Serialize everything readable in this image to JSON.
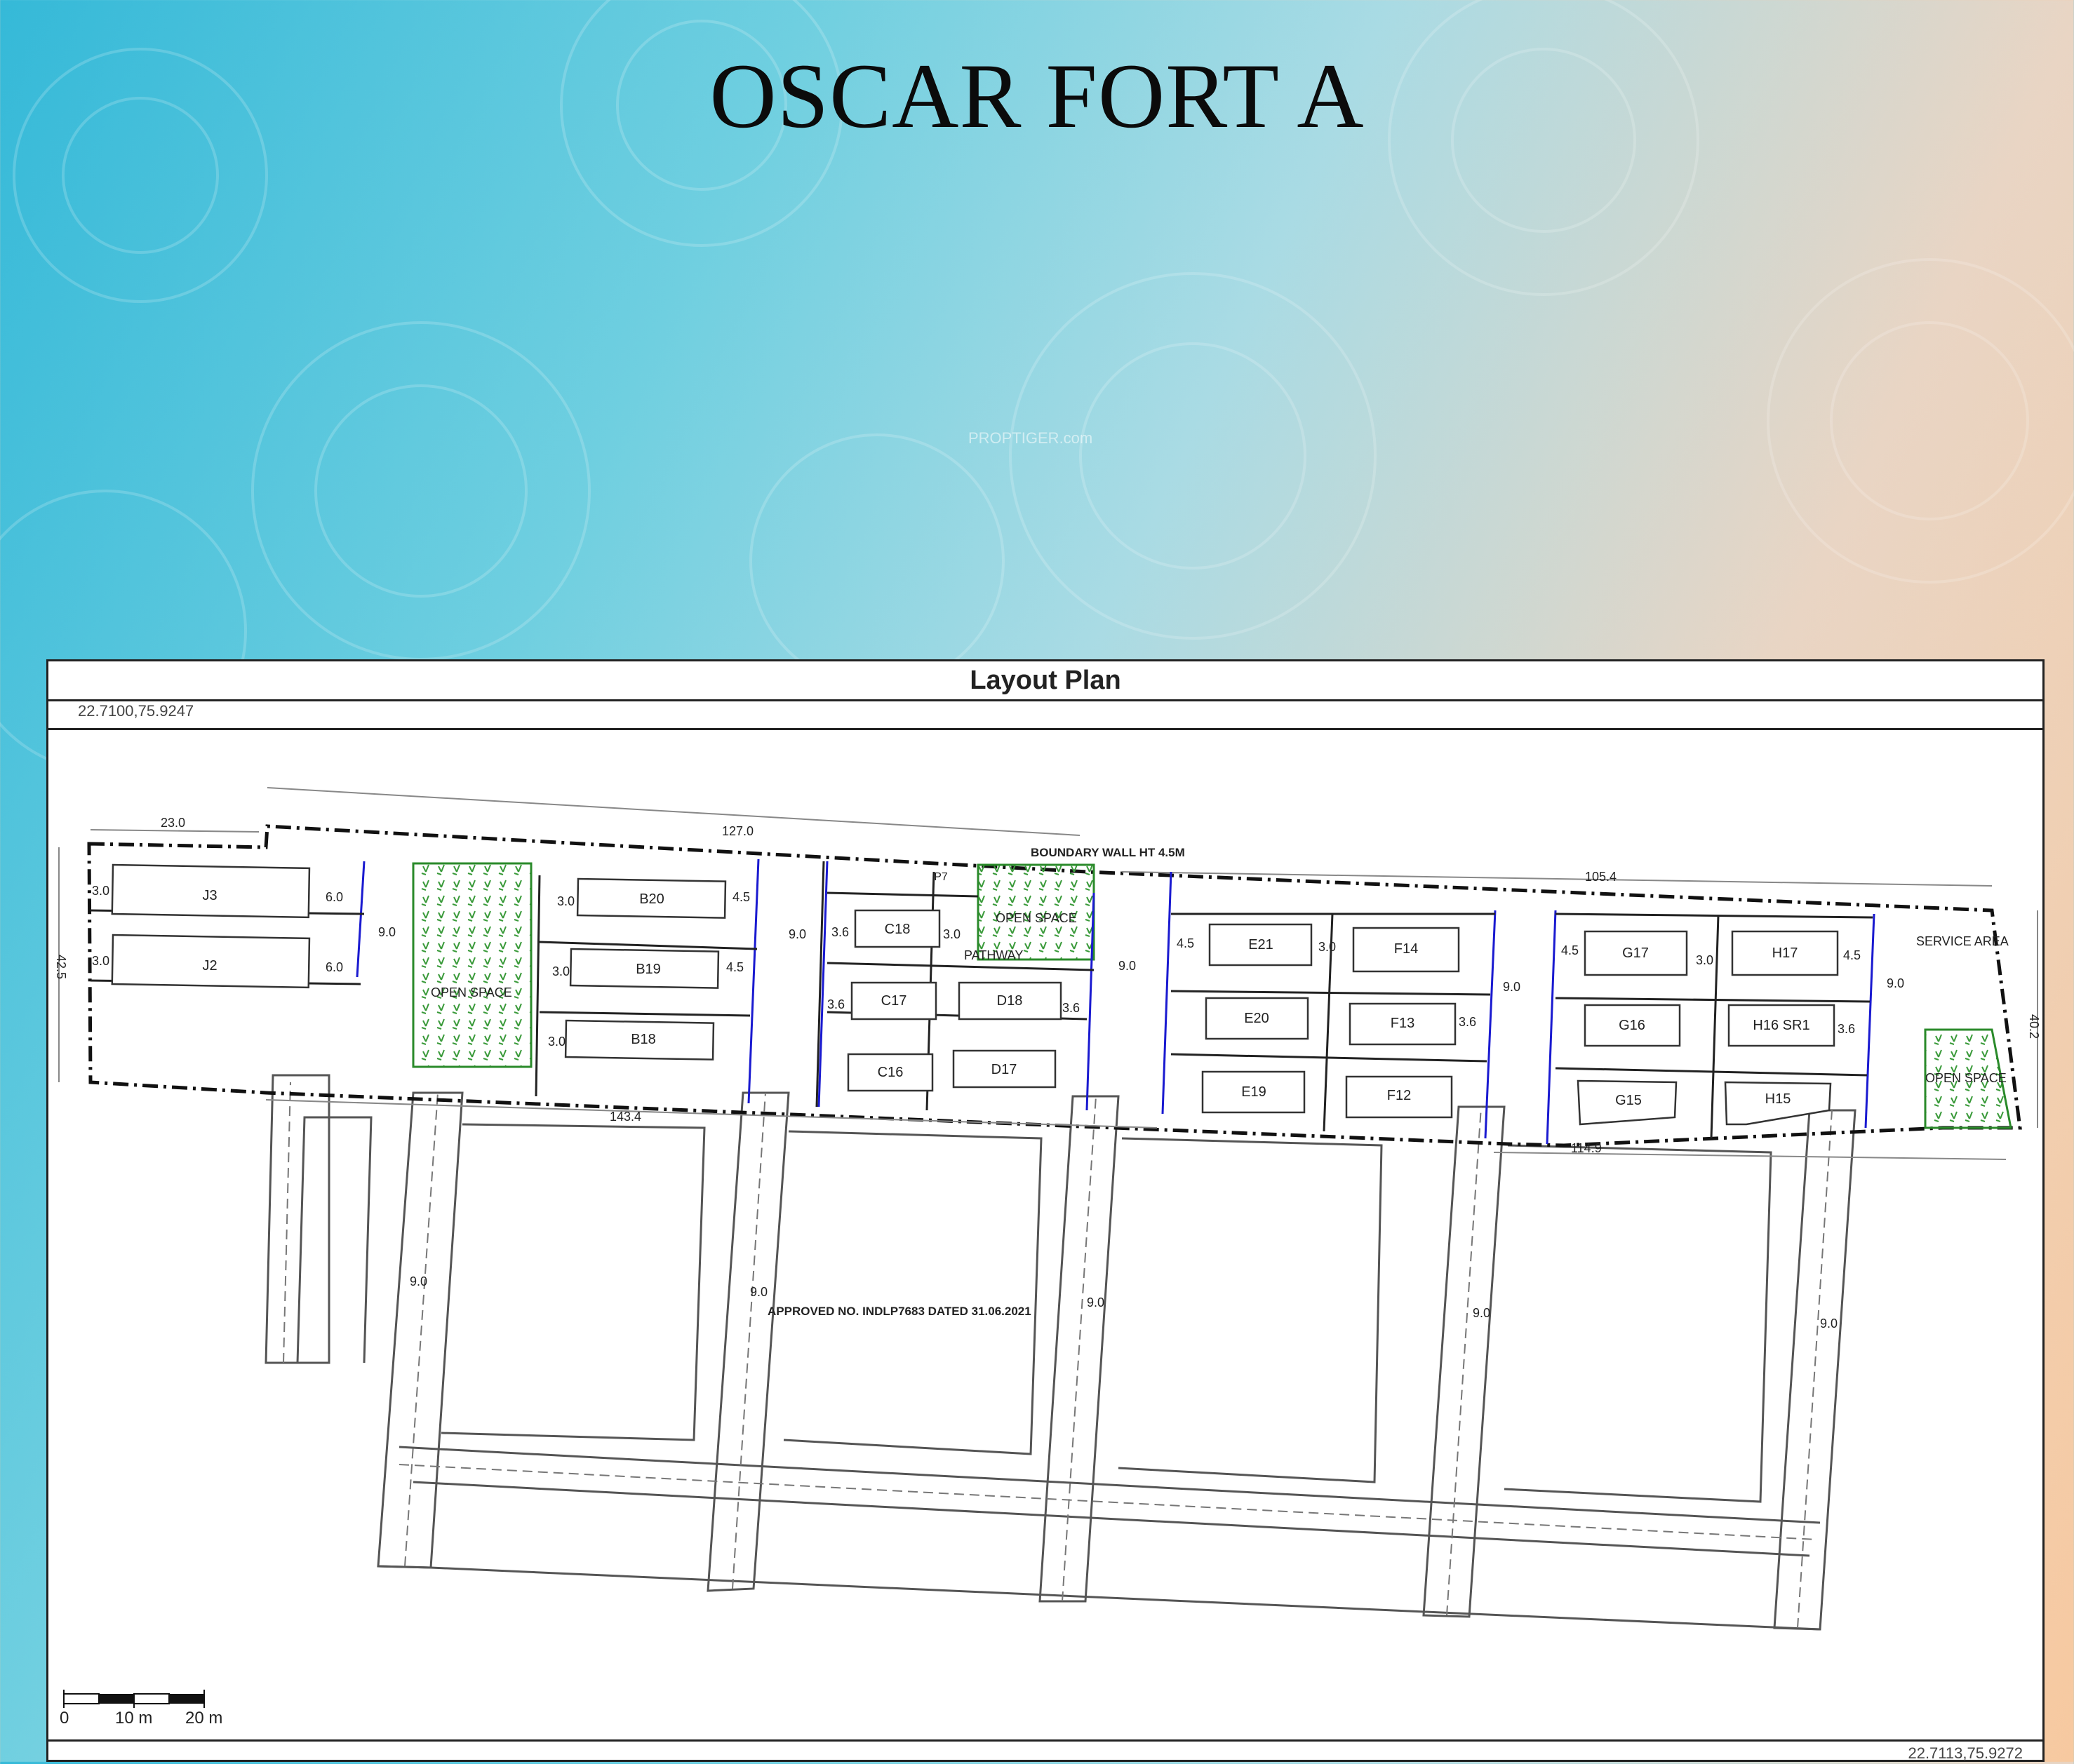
{
  "title": "OSCAR FORT A",
  "watermark": "PROPTIGER.com",
  "plan": {
    "heading": "Layout Plan",
    "coord_top_left": "22.7100,75.9247",
    "coord_bottom_right": "22.7113,75.9272",
    "boundary_label": "BOUNDARY WALL HT 4.5M",
    "approval_label": "APPROVED NO. INDLP7683 DATED 31.06.2021",
    "pathway_label": "PATHWAY",
    "service_area_label": "SERVICE AREA",
    "open_space_label": "OPEN SPACE",
    "scale": [
      "0",
      "10 m",
      "20 m"
    ],
    "dims": [
      "23.0",
      "127.0",
      "105.4",
      "143.4",
      "114.9",
      "42.5",
      "40.2",
      "9.0",
      "6.0",
      "4.5",
      "3.6",
      "3.0"
    ],
    "units": [
      "J3",
      "J2",
      "B20",
      "B19",
      "B18",
      "C18",
      "C17",
      "C16",
      "D18",
      "D17",
      "E21",
      "E20",
      "E19",
      "F14",
      "F13",
      "F12",
      "G17",
      "G16",
      "G15",
      "H17",
      "H16 SR1",
      "H15",
      "P7"
    ]
  }
}
